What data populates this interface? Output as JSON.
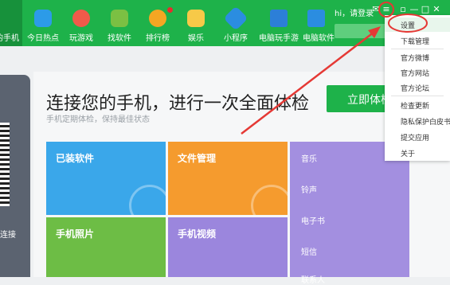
{
  "nav": {
    "current_label": "的手机",
    "items": [
      {
        "label": "今日热点",
        "icon": "news-icon",
        "color": "#2c9be8"
      },
      {
        "label": "玩游戏",
        "icon": "gamepad-icon",
        "color": "#f15a4a"
      },
      {
        "label": "找软件",
        "icon": "android-app-icon",
        "color": "#7bc043"
      },
      {
        "label": "排行榜",
        "icon": "ranking-medal-icon",
        "color": "#f5a623"
      },
      {
        "label": "娱乐",
        "icon": "entertainment-icon",
        "color": "#f7c948"
      },
      {
        "label": "小程序",
        "icon": "mini-program-icon",
        "color": "#2b8de0"
      },
      {
        "label": "电脑玩手游",
        "icon": "pc-mobile-game-icon",
        "color": "#2c7fd8"
      },
      {
        "label": "电脑软件",
        "icon": "pc-software-icon",
        "color": "#2b8de0"
      }
    ]
  },
  "user": {
    "greeting": "hi，请登录"
  },
  "menu": {
    "items": [
      "设置",
      "下载管理",
      "官方微博",
      "官方网站",
      "官方论坛",
      "检查更新",
      "隐私保护白皮书",
      "提交应用",
      "关于"
    ]
  },
  "main": {
    "headline": "连接您的手机，进行一次全面体检",
    "subline": "手机定期体检，保持最佳状态",
    "check_button": "立即体检",
    "left_caption": "连接"
  },
  "tiles": [
    {
      "label": "已装软件",
      "color": "#3aa7ea"
    },
    {
      "label": "文件管理",
      "color": "#f59b2e"
    },
    {
      "label": "手机照片",
      "color": "#6dbd45"
    },
    {
      "label": "手机视频",
      "color": "#9b86dd"
    }
  ],
  "side_list": {
    "items": [
      "音乐",
      "铃声",
      "电子书",
      "短信",
      "联系人"
    ]
  },
  "colors": {
    "topbar": "#1eb24a",
    "annotation_red": "#e53935"
  }
}
